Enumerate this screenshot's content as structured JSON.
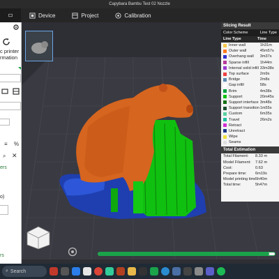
{
  "window": {
    "title": "Capybara Bambu Test 02 Nozzle"
  },
  "tabs": [
    {
      "label": "Device"
    },
    {
      "label": "Project"
    },
    {
      "label": "Calibration"
    }
  ],
  "sidebar": {
    "printer_text_1": "c printer",
    "printer_text_2": "rmation",
    "frag_ers": "ers",
    "frag_o": "o)",
    "frag_rs": "rs",
    "percent": "%"
  },
  "slicing": {
    "title": "Slicing Result",
    "color_scheme_label": "Color Scheme",
    "color_scheme_value": "Line Type",
    "col_type": "Line Type",
    "col_time": "Time",
    "rows": [
      {
        "name": "Inner wall",
        "time": "1h31m",
        "color": "#f7c84a"
      },
      {
        "name": "Outer wall",
        "time": "45m57s",
        "color": "#ff7a1c"
      },
      {
        "name": "Overhang wall",
        "time": "3m37s",
        "color": "#3030d0"
      },
      {
        "name": "Sparse infill",
        "time": "1h44m",
        "color": "#b83a9a"
      },
      {
        "name": "Internal solid infill",
        "time": "33m38s",
        "color": "#9a3ad0"
      },
      {
        "name": "Top surface",
        "time": "2m9s",
        "color": "#f04040"
      },
      {
        "name": "Bridge",
        "time": "2m8s",
        "color": "#5a8ab0"
      },
      {
        "name": "Gap infill",
        "time": "58s",
        "color": "#ffffff"
      },
      {
        "name": "Brim",
        "time": "4m38s",
        "color": "#00a040"
      },
      {
        "name": "Support",
        "time": "20m45s",
        "color": "#10c010"
      },
      {
        "name": "Support interface",
        "time": "3m48s",
        "color": "#107010"
      },
      {
        "name": "Support transition",
        "time": "1m55s",
        "color": "#1a5030"
      },
      {
        "name": "Custom",
        "time": "6m35s",
        "color": "#5ad0a0"
      },
      {
        "name": "Travel",
        "time": "26m2s",
        "color": "#20c0a0"
      },
      {
        "name": "Retract",
        "time": "",
        "color": "#d030d0"
      },
      {
        "name": "Unretract",
        "time": "",
        "color": "#1a3a8a"
      },
      {
        "name": "Wipe",
        "time": "",
        "color": "#f0e040"
      },
      {
        "name": "Seams",
        "time": "",
        "color": "#e0e0e0"
      }
    ],
    "estimation_title": "Total Estimation",
    "estimation": [
      {
        "label": "Total Filament:",
        "value": "8.33 m"
      },
      {
        "label": "Model Filament:",
        "value": "7.62 m"
      },
      {
        "label": "Cost:",
        "value": "0.63"
      },
      {
        "label": "Prepare time:",
        "value": "6m19s"
      },
      {
        "label": "Model printing time:",
        "value": "5h40m"
      },
      {
        "label": "Total time:",
        "value": "5h47m"
      }
    ]
  },
  "progress": {
    "fraction": 0.97
  },
  "taskbar": {
    "search_placeholder": "Search"
  },
  "colors": {
    "accent": "#1aa34a",
    "support": "#10c010",
    "model": "#d5651f",
    "brim": "#1f3fb0"
  }
}
